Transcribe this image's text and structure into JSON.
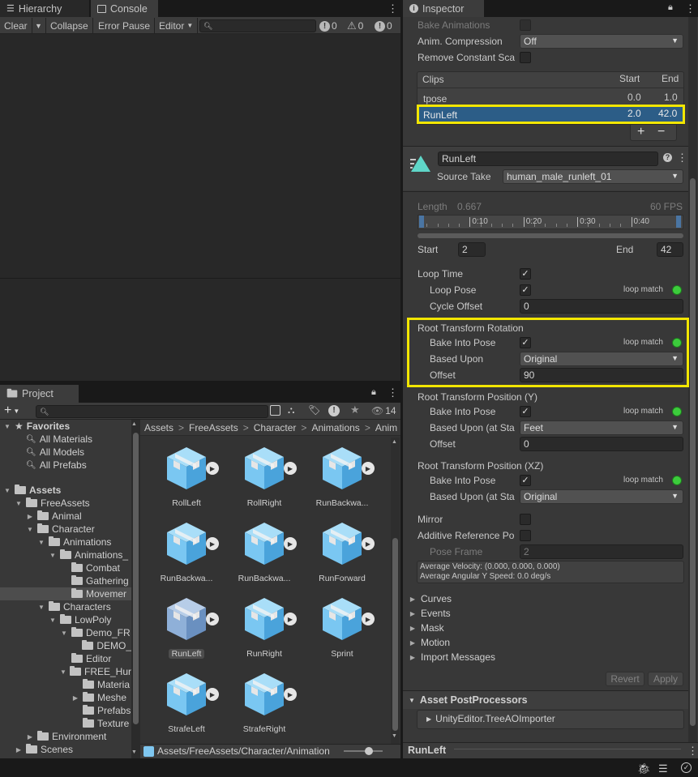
{
  "hierarchy_tab": "Hierarchy",
  "console": {
    "tab": "Console",
    "toolbar": {
      "clear": "Clear",
      "collapse": "Collapse",
      "error_pause": "Error Pause",
      "editor": "Editor"
    },
    "counts": {
      "errors": "0",
      "warnings": "0",
      "logs": "0"
    }
  },
  "project": {
    "tab": "Project",
    "filter_count": "14",
    "tree": [
      {
        "label": "Favorites",
        "level": 0,
        "arrow": "▼",
        "icon": "star"
      },
      {
        "label": "All Materials",
        "level": 1,
        "icon": "search"
      },
      {
        "label": "All Models",
        "level": 1,
        "icon": "search"
      },
      {
        "label": "All Prefabs",
        "level": 1,
        "icon": "search"
      },
      {
        "label": "Assets",
        "level": 0,
        "arrow": "▼",
        "icon": "folder"
      },
      {
        "label": "FreeAssets",
        "level": 1,
        "arrow": "▼",
        "icon": "folder"
      },
      {
        "label": "Animal",
        "level": 2,
        "arrow": "▶",
        "icon": "folder"
      },
      {
        "label": "Character",
        "level": 2,
        "arrow": "▼",
        "icon": "folder"
      },
      {
        "label": "Animations",
        "level": 3,
        "arrow": "▼",
        "icon": "folder"
      },
      {
        "label": "Animations_",
        "level": 4,
        "arrow": "▼",
        "icon": "folder"
      },
      {
        "label": "Combat",
        "level": 5,
        "icon": "folder"
      },
      {
        "label": "Gathering",
        "level": 5,
        "icon": "folder"
      },
      {
        "label": "Movemer",
        "level": 5,
        "icon": "folder",
        "selected": true
      },
      {
        "label": "Characters",
        "level": 3,
        "arrow": "▼",
        "icon": "folder"
      },
      {
        "label": "LowPoly",
        "level": 4,
        "arrow": "▼",
        "icon": "folder"
      },
      {
        "label": "Demo_FR",
        "level": 5,
        "arrow": "▼",
        "icon": "folder"
      },
      {
        "label": "DEMO_",
        "level": 6,
        "icon": "folder"
      },
      {
        "label": "Editor",
        "level": 5,
        "icon": "folder"
      },
      {
        "label": "FREE_Hur",
        "level": 5,
        "arrow": "▼",
        "icon": "folder"
      },
      {
        "label": "Materia",
        "level": 6,
        "icon": "folder"
      },
      {
        "label": "Meshe",
        "level": 6,
        "arrow": "▶",
        "icon": "folder"
      },
      {
        "label": "Prefabs",
        "level": 6,
        "icon": "folder"
      },
      {
        "label": "Texture",
        "level": 6,
        "icon": "folder"
      },
      {
        "label": "Environment",
        "level": 2,
        "arrow": "▶",
        "icon": "folder"
      },
      {
        "label": "Scenes",
        "level": 1,
        "arrow": "▶",
        "icon": "folder"
      }
    ],
    "breadcrumb": [
      "Assets",
      "FreeAssets",
      "Character",
      "Animations",
      "Anim"
    ],
    "assets": [
      "RollLeft",
      "RollRight",
      "RunBackwa...",
      "RunBackwa...",
      "RunBackwa...",
      "RunForward",
      "RunLeft",
      "RunRight",
      "Sprint",
      "StrafeLeft",
      "StrafeRight"
    ],
    "selected_asset": "RunLeft",
    "footer_path": "Assets/FreeAssets/Character/Animation"
  },
  "inspector": {
    "tab": "Inspector",
    "bake_animations": "Bake Animations",
    "anim_compression": {
      "label": "Anim. Compression",
      "value": "Off"
    },
    "remove_constant": "Remove Constant Sca",
    "clips": {
      "header": "Clips",
      "start_header": "Start",
      "end_header": "End",
      "rows": [
        {
          "name": "tpose",
          "start": "0.0",
          "end": "1.0"
        },
        {
          "name": "RunLeft",
          "start": "2.0",
          "end": "42.0",
          "selected": true
        }
      ],
      "add": "+",
      "remove": "−"
    },
    "clip_name": "RunLeft",
    "source_take": {
      "label": "Source Take",
      "value": "human_male_runleft_01"
    },
    "length": {
      "label": "Length",
      "value": "0.667",
      "fps": "60 FPS"
    },
    "timeline_ticks": [
      "0:10",
      "0:20",
      "0:30",
      "0:40"
    ],
    "start": {
      "label": "Start",
      "value": "2"
    },
    "end": {
      "label": "End",
      "value": "42"
    },
    "loop_time": "Loop Time",
    "loop_pose": "Loop Pose",
    "loop_match": "loop match",
    "cycle_offset": {
      "label": "Cycle Offset",
      "value": "0"
    },
    "rtr": {
      "title": "Root Transform Rotation",
      "bake": "Bake Into Pose",
      "based_upon": "Based Upon",
      "based_value": "Original",
      "offset": "Offset",
      "offset_value": "90"
    },
    "rtpy": {
      "title": "Root Transform Position (Y)",
      "bake": "Bake Into Pose",
      "based_upon": "Based Upon (at Sta",
      "based_value": "Feet",
      "offset": "Offset",
      "offset_value": "0"
    },
    "rtpxz": {
      "title": "Root Transform Position (XZ)",
      "bake": "Bake Into Pose",
      "based_upon": "Based Upon (at Sta",
      "based_value": "Original"
    },
    "mirror": "Mirror",
    "additive": "Additive Reference Po",
    "pose_frame": {
      "label": "Pose Frame",
      "value": "2"
    },
    "avg_velocity": "Average Velocity: (0.000, 0.000, 0.000)",
    "avg_angular": "Average Angular Y Speed: 0.0 deg/s",
    "foldouts": [
      "Curves",
      "Events",
      "Mask",
      "Motion",
      "Import Messages"
    ],
    "revert": "Revert",
    "apply": "Apply",
    "postprocessors": "Asset PostProcessors",
    "postprocessor_item": "UnityEditor.TreeAOImporter",
    "preview_name": "RunLeft"
  }
}
